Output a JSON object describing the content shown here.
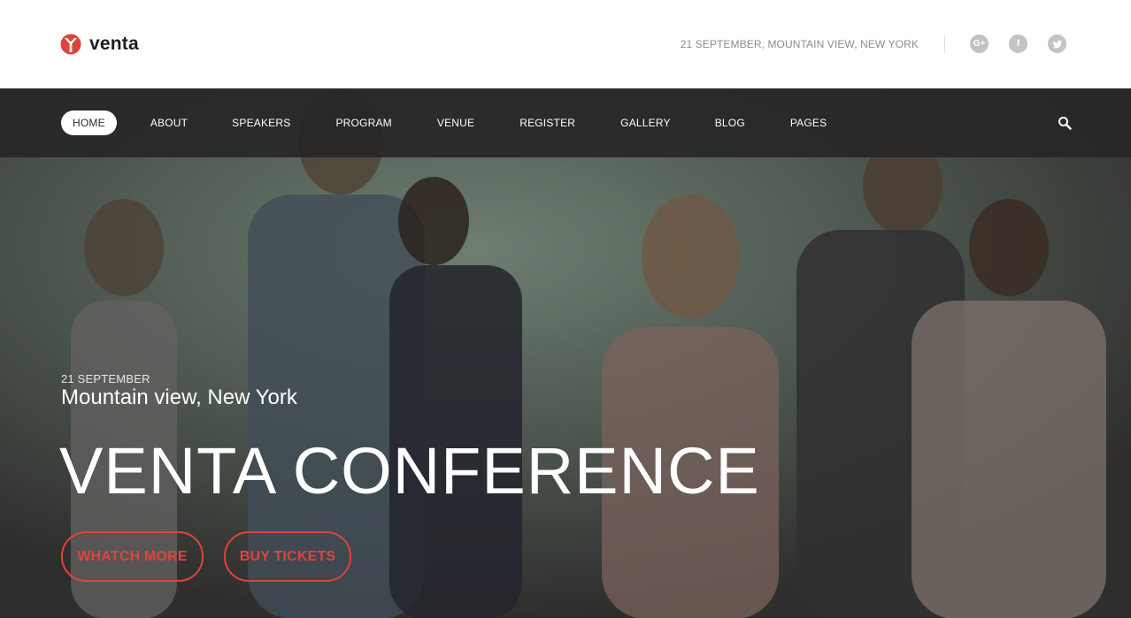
{
  "brand": {
    "name": "venta",
    "color": "#e0433a"
  },
  "header": {
    "event_info": "21 SEPTEMBER, MOUNTAIN VIEW, NEW YORK",
    "socials": [
      {
        "icon": "google-plus-icon",
        "glyph": "G+"
      },
      {
        "icon": "facebook-icon",
        "glyph": "f"
      },
      {
        "icon": "twitter-icon",
        "glyph": "t"
      }
    ]
  },
  "nav": {
    "items": [
      {
        "label": "HOME",
        "active": true
      },
      {
        "label": "ABOUT",
        "active": false
      },
      {
        "label": "SPEAKERS",
        "active": false
      },
      {
        "label": "PROGRAM",
        "active": false
      },
      {
        "label": "VENUE",
        "active": false
      },
      {
        "label": "REGISTER",
        "active": false
      },
      {
        "label": "GALLERY",
        "active": false
      },
      {
        "label": "BLOG",
        "active": false
      },
      {
        "label": "PAGES",
        "active": false
      }
    ],
    "search_icon": "search-icon"
  },
  "hero": {
    "date": "21 SEPTEMBER",
    "location": "Mountain view, New York",
    "headline": "VENTA CONFERENCE",
    "buttons": {
      "watch_more": "WHATCH MORE",
      "buy_tickets": "BUY TICKETS"
    }
  }
}
